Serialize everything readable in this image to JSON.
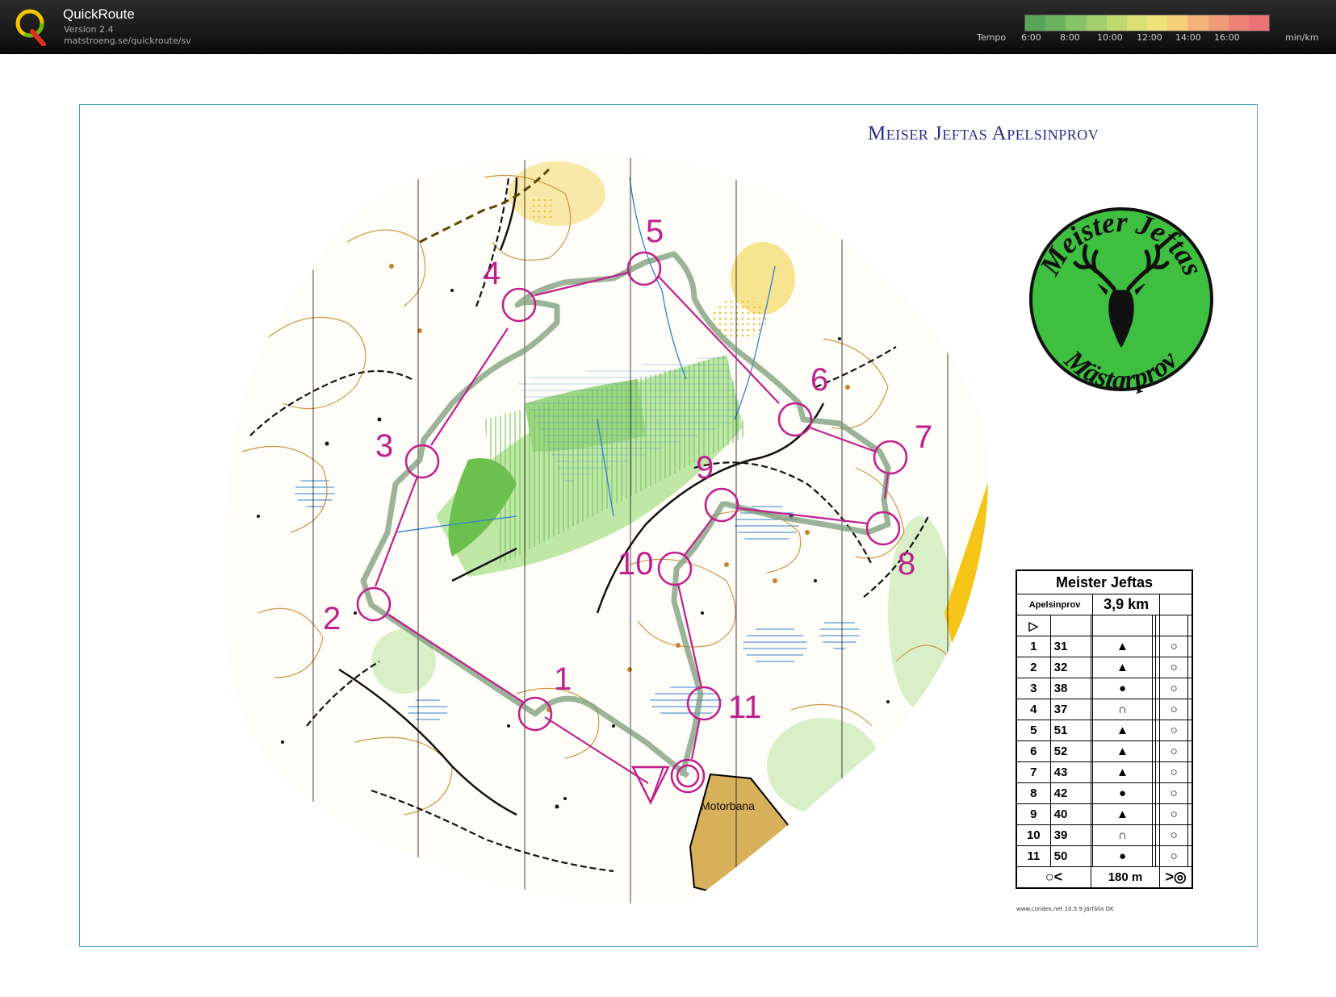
{
  "app": {
    "name": "QuickRoute",
    "version": "Version 2.4",
    "url": "matstroeng.se/quickroute/sv"
  },
  "tempo_legend": {
    "label": "Tempo",
    "ticks": [
      "6:00",
      "8:00",
      "10:00",
      "12:00",
      "14:00",
      "16:00"
    ],
    "unit": "min/km",
    "colors": [
      "#5aa35a",
      "#6cb25e",
      "#86c266",
      "#a2cf6c",
      "#bfd971",
      "#dbe076",
      "#efe27a",
      "#f4cf78",
      "#f3b376",
      "#f19a77",
      "#ee8276",
      "#ec7276"
    ]
  },
  "map": {
    "title": "Meiser Jeftas Apelsinprov",
    "logo": {
      "top_text": "Meister Jeftas",
      "bottom_text": "Mästarprov",
      "icon": "stag-head-icon",
      "color": "#3fbf3f"
    },
    "place_label": "Motorbana",
    "course_color": "#c0208e",
    "route_color": "#6f8f6f",
    "controls": [
      {
        "num": "1"
      },
      {
        "num": "2"
      },
      {
        "num": "3"
      },
      {
        "num": "4"
      },
      {
        "num": "5"
      },
      {
        "num": "6"
      },
      {
        "num": "7"
      },
      {
        "num": "8"
      },
      {
        "num": "9"
      },
      {
        "num": "10"
      },
      {
        "num": "11"
      }
    ]
  },
  "control_card": {
    "event": "Meister Jeftas",
    "course": "Apelsinprov",
    "length": "3,9 km",
    "start_symbol": "▷",
    "rows": [
      {
        "n": "1",
        "code": "31",
        "feature": "▲"
      },
      {
        "n": "2",
        "code": "32",
        "feature": "▲"
      },
      {
        "n": "3",
        "code": "38",
        "feature": "●"
      },
      {
        "n": "4",
        "code": "37",
        "feature": "∩"
      },
      {
        "n": "5",
        "code": "51",
        "feature": "▲"
      },
      {
        "n": "6",
        "code": "52",
        "feature": "▲"
      },
      {
        "n": "7",
        "code": "43",
        "feature": "▲"
      },
      {
        "n": "8",
        "code": "42",
        "feature": "●"
      },
      {
        "n": "9",
        "code": "40",
        "feature": "▲"
      },
      {
        "n": "10",
        "code": "39",
        "feature": "∩"
      },
      {
        "n": "11",
        "code": "50",
        "feature": "●"
      }
    ],
    "finish_distance": "180 m",
    "credit": "www.condes.net 10.5.9 Järfälla OK"
  }
}
